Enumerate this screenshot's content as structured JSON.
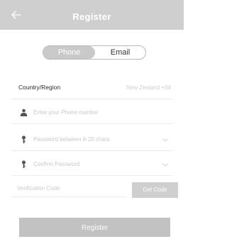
{
  "header": {
    "title": "Register",
    "back_icon": "arrow-left-icon"
  },
  "tabs": {
    "phone_label": "Phone",
    "email_label": "Email",
    "selected": "Phone"
  },
  "form": {
    "country_label": "Country/Region",
    "country_value": "New Zealand +64",
    "phone_placeholder": "Enter your Phone number",
    "password_placeholder": "Password between 6-20 chars",
    "confirm_placeholder": "Confirm Password",
    "verification_placeholder": "Verification Code",
    "get_code_label": "Get Code"
  },
  "actions": {
    "register_label": "Register"
  },
  "colors": {
    "header_bg": "#cfcfcf",
    "button_bg": "#c2c2c2",
    "active_tab_bg": "#c9c9c9"
  }
}
